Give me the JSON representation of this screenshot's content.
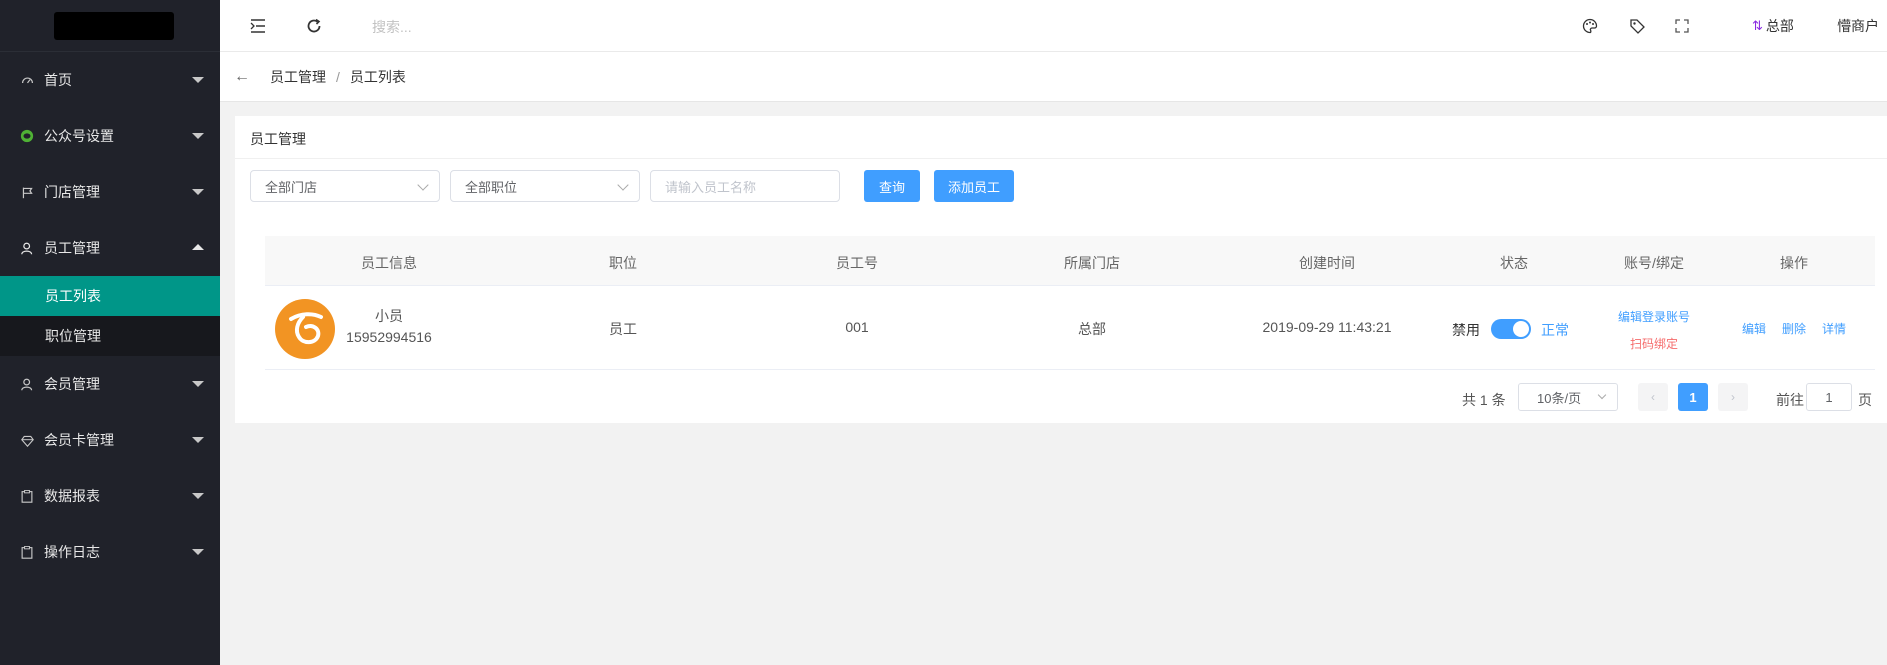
{
  "sidebar": {
    "items": [
      {
        "label": "首页",
        "icon": "gauge-icon"
      },
      {
        "label": "公众号设置",
        "icon": "wechat-icon"
      },
      {
        "label": "门店管理",
        "icon": "flag-icon"
      },
      {
        "label": "员工管理",
        "icon": "user-icon",
        "expanded": true,
        "children": [
          {
            "label": "员工列表",
            "active": true
          },
          {
            "label": "职位管理"
          }
        ]
      },
      {
        "label": "会员管理",
        "icon": "user-icon"
      },
      {
        "label": "会员卡管理",
        "icon": "diamond-icon"
      },
      {
        "label": "数据报表",
        "icon": "clipboard-icon"
      },
      {
        "label": "操作日志",
        "icon": "clipboard-icon"
      }
    ]
  },
  "header": {
    "search_placeholder": "搜索...",
    "store_label": "总部",
    "user_label": "懵商户"
  },
  "breadcrumb": {
    "items": [
      "员工管理",
      "员工列表"
    ],
    "separator": "/"
  },
  "panel": {
    "title": "员工管理",
    "filters": {
      "store_select": "全部门店",
      "position_select": "全部职位",
      "name_placeholder": "请输入员工名称",
      "query_button": "查询",
      "add_button": "添加员工"
    }
  },
  "table": {
    "columns": [
      "员工信息",
      "职位",
      "员工号",
      "所属门店",
      "创建时间",
      "状态",
      "账号/绑定",
      "操作"
    ],
    "rows": [
      {
        "name": "小员",
        "phone": "15952994516",
        "position": "员工",
        "employee_no": "001",
        "store": "总部",
        "created": "2019-09-29 11:43:21",
        "status_off_label": "禁用",
        "status_on_label": "正常",
        "status_on": true,
        "edit_login": "编辑登录账号",
        "scan_bind": "扫码绑定",
        "edit": "编辑",
        "delete": "删除",
        "detail": "详情"
      }
    ]
  },
  "pagination": {
    "total": "共 1 条",
    "page_size": "10条/页",
    "current": "1",
    "goto_label": "前往",
    "goto_value": "1",
    "page_suffix": "页"
  },
  "colors": {
    "sidebar_bg": "#20222a",
    "active_item": "#009688",
    "primary": "#409eff",
    "danger": "#f56c6c",
    "avatar": "#f29423"
  }
}
